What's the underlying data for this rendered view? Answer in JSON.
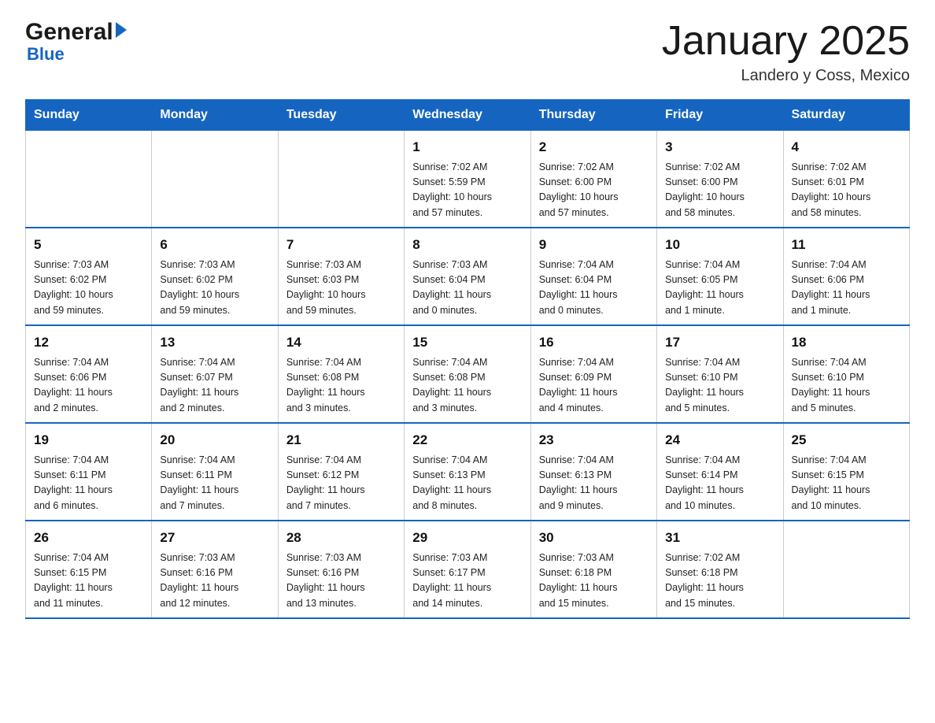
{
  "header": {
    "title": "January 2025",
    "subtitle": "Landero y Coss, Mexico",
    "logo_general": "General",
    "logo_blue": "Blue"
  },
  "days_of_week": [
    "Sunday",
    "Monday",
    "Tuesday",
    "Wednesday",
    "Thursday",
    "Friday",
    "Saturday"
  ],
  "weeks": [
    [
      {
        "day": "",
        "info": ""
      },
      {
        "day": "",
        "info": ""
      },
      {
        "day": "",
        "info": ""
      },
      {
        "day": "1",
        "info": "Sunrise: 7:02 AM\nSunset: 5:59 PM\nDaylight: 10 hours\nand 57 minutes."
      },
      {
        "day": "2",
        "info": "Sunrise: 7:02 AM\nSunset: 6:00 PM\nDaylight: 10 hours\nand 57 minutes."
      },
      {
        "day": "3",
        "info": "Sunrise: 7:02 AM\nSunset: 6:00 PM\nDaylight: 10 hours\nand 58 minutes."
      },
      {
        "day": "4",
        "info": "Sunrise: 7:02 AM\nSunset: 6:01 PM\nDaylight: 10 hours\nand 58 minutes."
      }
    ],
    [
      {
        "day": "5",
        "info": "Sunrise: 7:03 AM\nSunset: 6:02 PM\nDaylight: 10 hours\nand 59 minutes."
      },
      {
        "day": "6",
        "info": "Sunrise: 7:03 AM\nSunset: 6:02 PM\nDaylight: 10 hours\nand 59 minutes."
      },
      {
        "day": "7",
        "info": "Sunrise: 7:03 AM\nSunset: 6:03 PM\nDaylight: 10 hours\nand 59 minutes."
      },
      {
        "day": "8",
        "info": "Sunrise: 7:03 AM\nSunset: 6:04 PM\nDaylight: 11 hours\nand 0 minutes."
      },
      {
        "day": "9",
        "info": "Sunrise: 7:04 AM\nSunset: 6:04 PM\nDaylight: 11 hours\nand 0 minutes."
      },
      {
        "day": "10",
        "info": "Sunrise: 7:04 AM\nSunset: 6:05 PM\nDaylight: 11 hours\nand 1 minute."
      },
      {
        "day": "11",
        "info": "Sunrise: 7:04 AM\nSunset: 6:06 PM\nDaylight: 11 hours\nand 1 minute."
      }
    ],
    [
      {
        "day": "12",
        "info": "Sunrise: 7:04 AM\nSunset: 6:06 PM\nDaylight: 11 hours\nand 2 minutes."
      },
      {
        "day": "13",
        "info": "Sunrise: 7:04 AM\nSunset: 6:07 PM\nDaylight: 11 hours\nand 2 minutes."
      },
      {
        "day": "14",
        "info": "Sunrise: 7:04 AM\nSunset: 6:08 PM\nDaylight: 11 hours\nand 3 minutes."
      },
      {
        "day": "15",
        "info": "Sunrise: 7:04 AM\nSunset: 6:08 PM\nDaylight: 11 hours\nand 3 minutes."
      },
      {
        "day": "16",
        "info": "Sunrise: 7:04 AM\nSunset: 6:09 PM\nDaylight: 11 hours\nand 4 minutes."
      },
      {
        "day": "17",
        "info": "Sunrise: 7:04 AM\nSunset: 6:10 PM\nDaylight: 11 hours\nand 5 minutes."
      },
      {
        "day": "18",
        "info": "Sunrise: 7:04 AM\nSunset: 6:10 PM\nDaylight: 11 hours\nand 5 minutes."
      }
    ],
    [
      {
        "day": "19",
        "info": "Sunrise: 7:04 AM\nSunset: 6:11 PM\nDaylight: 11 hours\nand 6 minutes."
      },
      {
        "day": "20",
        "info": "Sunrise: 7:04 AM\nSunset: 6:11 PM\nDaylight: 11 hours\nand 7 minutes."
      },
      {
        "day": "21",
        "info": "Sunrise: 7:04 AM\nSunset: 6:12 PM\nDaylight: 11 hours\nand 7 minutes."
      },
      {
        "day": "22",
        "info": "Sunrise: 7:04 AM\nSunset: 6:13 PM\nDaylight: 11 hours\nand 8 minutes."
      },
      {
        "day": "23",
        "info": "Sunrise: 7:04 AM\nSunset: 6:13 PM\nDaylight: 11 hours\nand 9 minutes."
      },
      {
        "day": "24",
        "info": "Sunrise: 7:04 AM\nSunset: 6:14 PM\nDaylight: 11 hours\nand 10 minutes."
      },
      {
        "day": "25",
        "info": "Sunrise: 7:04 AM\nSunset: 6:15 PM\nDaylight: 11 hours\nand 10 minutes."
      }
    ],
    [
      {
        "day": "26",
        "info": "Sunrise: 7:04 AM\nSunset: 6:15 PM\nDaylight: 11 hours\nand 11 minutes."
      },
      {
        "day": "27",
        "info": "Sunrise: 7:03 AM\nSunset: 6:16 PM\nDaylight: 11 hours\nand 12 minutes."
      },
      {
        "day": "28",
        "info": "Sunrise: 7:03 AM\nSunset: 6:16 PM\nDaylight: 11 hours\nand 13 minutes."
      },
      {
        "day": "29",
        "info": "Sunrise: 7:03 AM\nSunset: 6:17 PM\nDaylight: 11 hours\nand 14 minutes."
      },
      {
        "day": "30",
        "info": "Sunrise: 7:03 AM\nSunset: 6:18 PM\nDaylight: 11 hours\nand 15 minutes."
      },
      {
        "day": "31",
        "info": "Sunrise: 7:02 AM\nSunset: 6:18 PM\nDaylight: 11 hours\nand 15 minutes."
      },
      {
        "day": "",
        "info": ""
      }
    ]
  ]
}
